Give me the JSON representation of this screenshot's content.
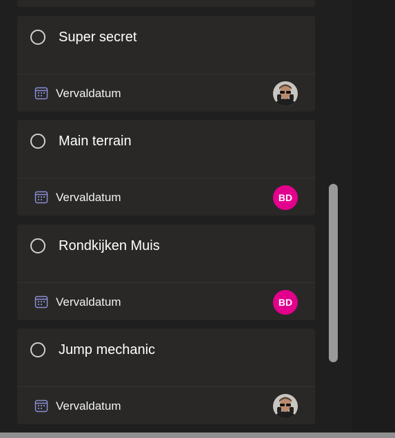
{
  "tasks": [
    {
      "title": "Super secret",
      "due_label": "Vervaldatum",
      "assignee": {
        "type": "photo",
        "initials": ""
      }
    },
    {
      "title": "Main terrain",
      "due_label": "Vervaldatum",
      "assignee": {
        "type": "initials",
        "initials": "BD"
      }
    },
    {
      "title": "Rondkijken Muis",
      "due_label": "Vervaldatum",
      "assignee": {
        "type": "initials",
        "initials": "BD"
      }
    },
    {
      "title": "Jump mechanic",
      "due_label": "Vervaldatum",
      "assignee": {
        "type": "photo",
        "initials": ""
      }
    }
  ],
  "colors": {
    "background": "#1f1f1f",
    "card": "#292827",
    "avatar_initials_bg": "#e3008c",
    "scrollbar_thumb": "#9a9a9a",
    "calendar_icon": "#8a8fd6"
  },
  "icons": {
    "complete_toggle": "circle-outline-icon",
    "due_date": "calendar-icon",
    "avatar_photo": "user-photo-icon"
  }
}
